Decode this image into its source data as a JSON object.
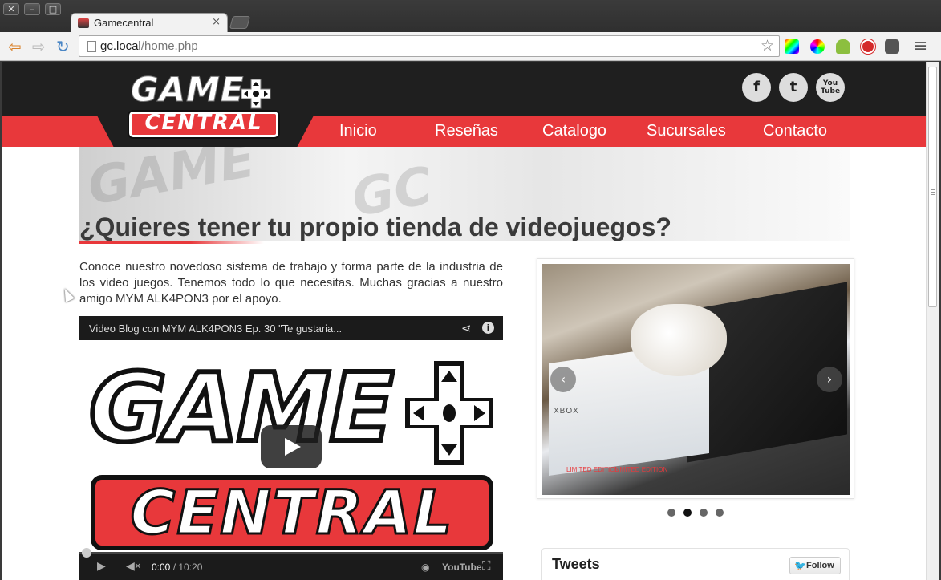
{
  "window": {
    "close_glyph": "✕",
    "minimize_glyph": "–",
    "maximize_glyph": "□"
  },
  "tab": {
    "title": "Gamecentral",
    "close_glyph": "×"
  },
  "toolbar": {
    "url_host": "gc.local",
    "url_path": "/home.php",
    "back_glyph": "⇦",
    "forward_glyph": "⇨",
    "reload_glyph": "↻",
    "star_glyph": "☆",
    "menu_glyph": "≡",
    "extensions": [
      "color-picker-icon",
      "color-wheel-icon",
      "android-icon",
      "adblock-icon",
      "pocket-icon"
    ]
  },
  "site": {
    "logo_top": "GAME",
    "logo_bottom": "CENTRAL",
    "social": {
      "facebook": "f",
      "twitter": "t",
      "youtube_line1": "You",
      "youtube_line2": "Tube"
    },
    "nav": [
      "Inicio",
      "Reseñas",
      "Catalogo",
      "Sucursales",
      "Contacto"
    ],
    "headline": "¿Quieres tener tu propio tienda de videojuegos?",
    "intro": "Conoce nuestro novedoso sistema de trabajo y forma parte de la industria de los video juegos. Tenemos todo lo que necesitas. Muchas gracias a nuestro amigo MYM ALK4PON3 por el apoyo."
  },
  "video": {
    "title": "Video Blog con MYM ALK4PON3 Ep. 30 \"Te gustaria...",
    "thumb_top": "GAME",
    "thumb_bottom": "CENTRAL",
    "time_current": "0:00",
    "time_separator": " / ",
    "time_total": "10:20",
    "youtube_label": "YouTube",
    "progress": 0
  },
  "slider": {
    "xbox_label": "XBOX",
    "edition_label": "LIMITED EDITION",
    "prev_glyph": "‹",
    "next_glyph": "›",
    "dots": 4,
    "active_dot": 1
  },
  "tweets": {
    "title": "Tweets",
    "follow_label": "Follow"
  },
  "colors": {
    "accent_red": "#e8383b",
    "header_dark": "#1f1f1f",
    "twitter_blue": "#2a9fd6"
  }
}
